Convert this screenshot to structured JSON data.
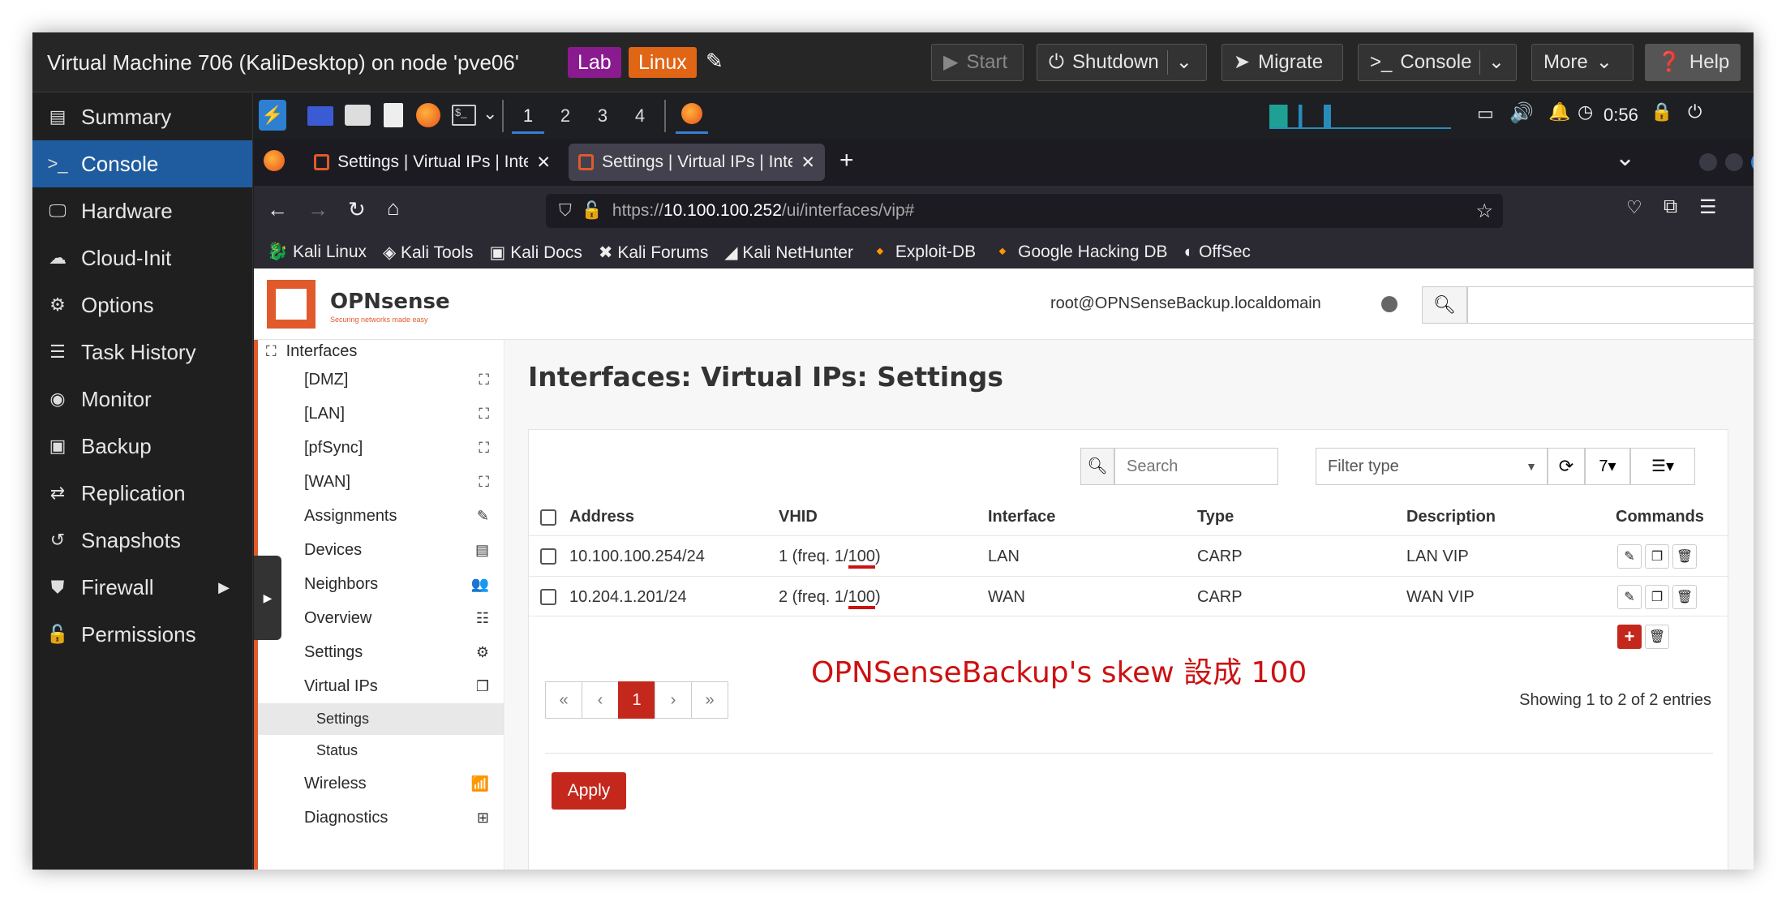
{
  "pve": {
    "title": "Virtual Machine 706 (KaliDesktop) on node 'pve06'",
    "tags": [
      {
        "label": "Lab",
        "color": "#8a1b8f"
      },
      {
        "label": "Linux",
        "color": "#e06515"
      }
    ],
    "buttons": {
      "start": "Start",
      "shutdown": "Shutdown",
      "migrate": "Migrate",
      "console": "Console",
      "more": "More",
      "help": "Help"
    },
    "nav": [
      "Summary",
      "Console",
      "Hardware",
      "Cloud-Init",
      "Options",
      "Task History",
      "Monitor",
      "Backup",
      "Replication",
      "Snapshots",
      "Firewall",
      "Permissions"
    ],
    "active_nav": "Console"
  },
  "kali": {
    "workspaces": [
      "1",
      "2",
      "3",
      "4"
    ],
    "clock": "0:56"
  },
  "browser": {
    "tabs": [
      "Settings | Virtual IPs | Inte",
      "Settings | Virtual IPs | Inte"
    ],
    "url_prefix": "https://",
    "url_host": "10.100.100.252",
    "url_path": "/ui/interfaces/vip#",
    "bookmarks": [
      "Kali Linux",
      "Kali Tools",
      "Kali Docs",
      "Kali Forums",
      "Kali NetHunter",
      "Exploit-DB",
      "Google Hacking DB",
      "OffSec"
    ]
  },
  "opnsense": {
    "logo": "OPNsense",
    "logo_tagline": "Securing networks made easy",
    "user": "root@OPNSenseBackup.localdomain",
    "sidebar": {
      "section": "Interfaces",
      "items": [
        "[DMZ]",
        "[LAN]",
        "[pfSync]",
        "[WAN]",
        "Assignments",
        "Devices",
        "Neighbors",
        "Overview",
        "Settings",
        "Virtual IPs"
      ],
      "subitems": [
        "Settings",
        "Status"
      ],
      "after": [
        "Wireless",
        "Diagnostics"
      ]
    },
    "page_title": "Interfaces: Virtual IPs: Settings",
    "search_placeholder": "Search",
    "filter_placeholder": "Filter type",
    "rows_per_page": "7",
    "columns": [
      "Address",
      "VHID",
      "Interface",
      "Type",
      "Description",
      "Commands"
    ],
    "rows": [
      {
        "address": "10.100.100.254/24",
        "vhid_a": "1 (freq. 1/",
        "vhid_b": "100",
        "vhid_c": ")",
        "interface": "LAN",
        "type": "CARP",
        "description": "LAN VIP"
      },
      {
        "address": "10.204.1.201/24",
        "vhid_a": "2 (freq. 1/",
        "vhid_b": "100",
        "vhid_c": ")",
        "interface": "WAN",
        "type": "CARP",
        "description": "WAN VIP"
      }
    ],
    "pagination": {
      "first": "«",
      "prev": "‹",
      "current": "1",
      "next": "›",
      "last": "»"
    },
    "showing": "Showing 1 to 2 of 2 entries",
    "apply": "Apply"
  },
  "annotation": {
    "text": "OPNSenseBackup's skew 設成 100",
    "color": "#cc1111"
  }
}
